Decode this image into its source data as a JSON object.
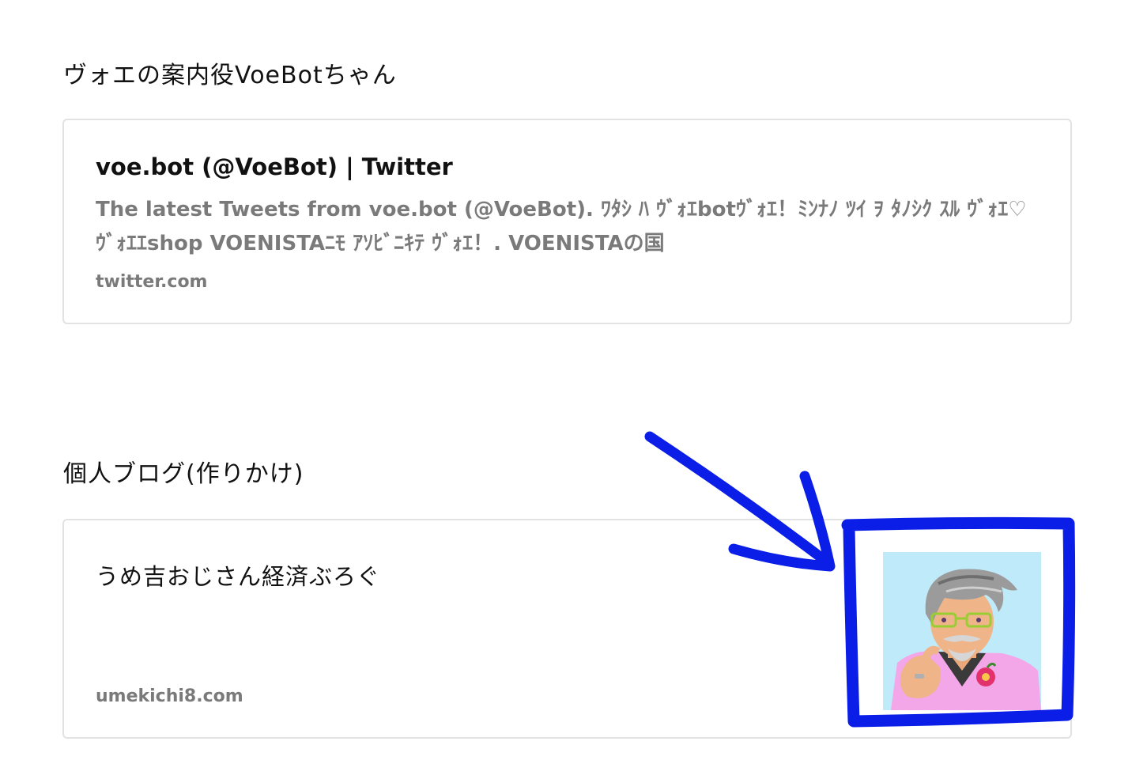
{
  "sections": [
    {
      "heading": "ヴォエの案内役VoeBotちゃん",
      "card": {
        "title": "voe.bot (@VoeBot) | Twitter",
        "description": "The latest Tweets from voe.bot (@VoeBot). ﾜﾀｼ ﾊ ｳﾞｫｴbotｳﾞｫｴ！ﾐﾝﾅﾉ ﾂｲ ｦ ﾀﾉｼｸ ｽﾙ ｳﾞｫｴ♡ ｳﾞｫｴｴshop VOENISTAﾆﾓ ｱｿﾋﾞﾆｷﾃ ｳﾞｫｴ！. VOENISTAの国",
        "domain": "twitter.com"
      }
    },
    {
      "heading": "個人ブログ(作りかけ)",
      "card": {
        "title": "うめ吉おじさん経済ぶろぐ",
        "domain": "umekichi8.com",
        "thumbnail_icon": "man-with-glasses-avatar-icon"
      }
    }
  ],
  "annotation": {
    "color": "#0a1ee8",
    "shapes": [
      "arrow-icon",
      "highlight-box"
    ]
  }
}
